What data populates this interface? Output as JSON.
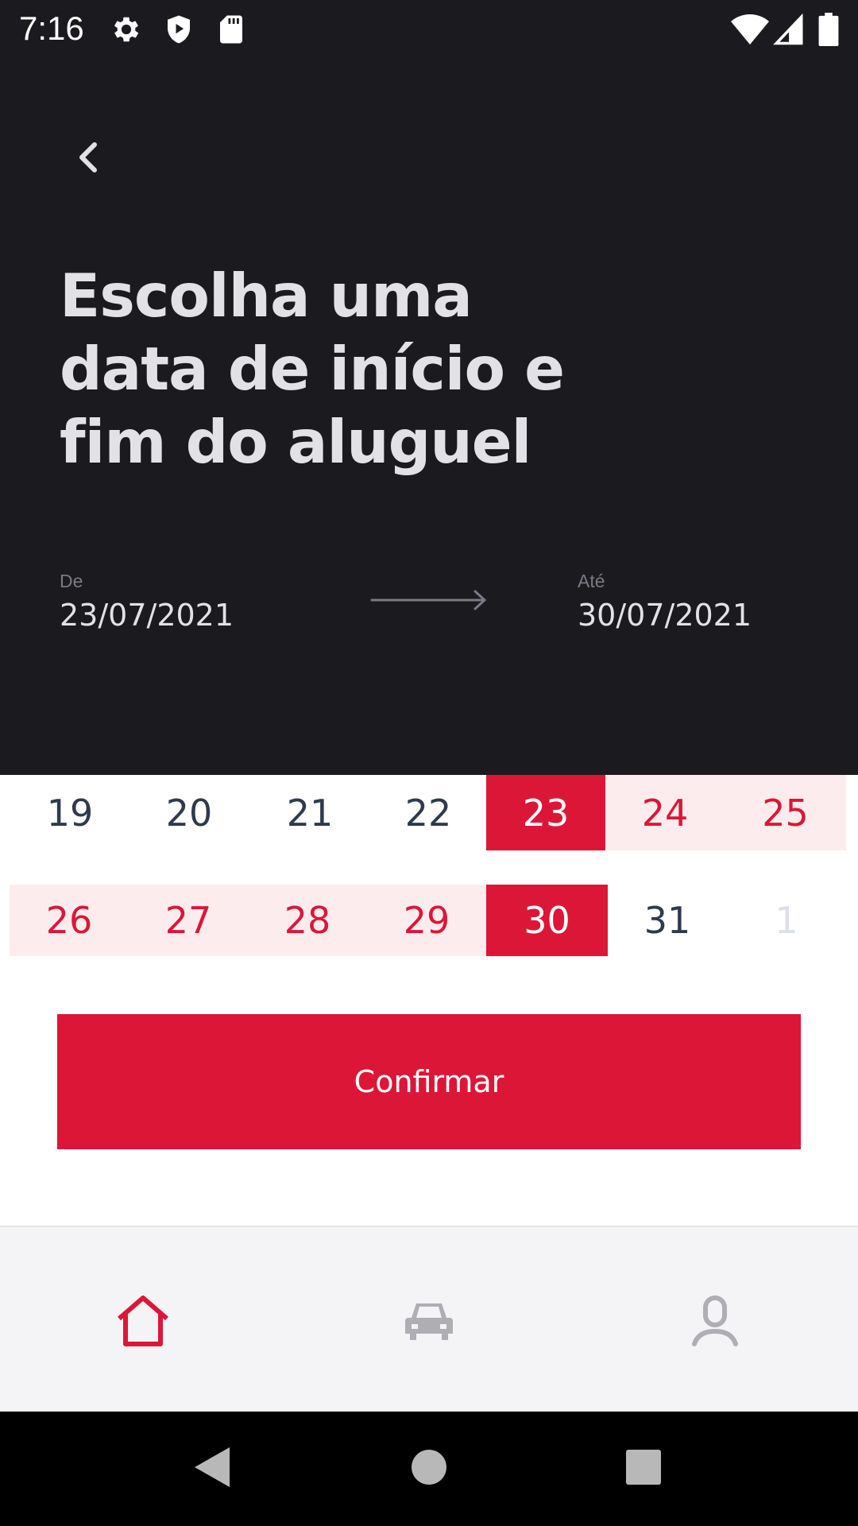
{
  "status_bar": {
    "time": "7:16",
    "left_icons": [
      "gear-icon",
      "shield-play-icon",
      "sd-card-icon"
    ],
    "right_icons": [
      "wifi-icon",
      "cell-signal-icon",
      "battery-icon"
    ]
  },
  "header": {
    "back_icon": "chevron-left-icon",
    "title": "Escolha uma data de início e fim do aluguel",
    "from_label": "De",
    "from_value": "23/07/2021",
    "to_label": "Até",
    "to_value": "30/07/2021",
    "arrow_icon": "arrow-right-icon"
  },
  "calendar": {
    "weeks": [
      [
        {
          "day": "19",
          "state": "normal"
        },
        {
          "day": "20",
          "state": "normal"
        },
        {
          "day": "21",
          "state": "normal"
        },
        {
          "day": "22",
          "state": "normal"
        },
        {
          "day": "23",
          "state": "selected"
        },
        {
          "day": "24",
          "state": "in-range"
        },
        {
          "day": "25",
          "state": "in-range"
        }
      ],
      [
        {
          "day": "26",
          "state": "in-range"
        },
        {
          "day": "27",
          "state": "in-range"
        },
        {
          "day": "28",
          "state": "in-range"
        },
        {
          "day": "29",
          "state": "in-range"
        },
        {
          "day": "30",
          "state": "selected"
        },
        {
          "day": "31",
          "state": "normal"
        },
        {
          "day": "1",
          "state": "muted"
        }
      ]
    ]
  },
  "confirm_label": "Confirmar",
  "bottom_nav": {
    "items": [
      {
        "icon": "home-icon",
        "active": true
      },
      {
        "icon": "car-icon",
        "active": false
      },
      {
        "icon": "user-icon",
        "active": false
      }
    ]
  },
  "colors": {
    "accent": "#dc1637",
    "header_bg": "#1b1b1f",
    "range_bg": "#fdecee",
    "inactive_icon": "#aeaeb3"
  }
}
